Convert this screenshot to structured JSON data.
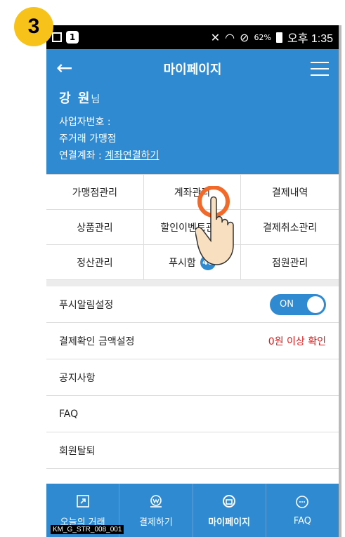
{
  "step_number": "3",
  "status_bar": {
    "indicator": "1",
    "battery": "62%",
    "time": "오후 1:35"
  },
  "header": {
    "title": "마이페이지",
    "user_name": "강 원",
    "user_suffix": "님",
    "business_number_label": "사업자번호 :",
    "main_merchant_label": "주거래 가맹점",
    "linked_account_label": "연결계좌 : ",
    "linked_account_link": "계좌연결하기"
  },
  "grid": [
    {
      "label": "가맹점관리"
    },
    {
      "label": "계좌관리"
    },
    {
      "label": "결제내역"
    },
    {
      "label": "상품관리"
    },
    {
      "label": "할인이벤트관리"
    },
    {
      "label": "결제취소관리"
    },
    {
      "label": "정산관리"
    },
    {
      "label": "푸시함",
      "count": "48"
    },
    {
      "label": "점원관리"
    }
  ],
  "settings": {
    "push_label": "푸시알림설정",
    "push_toggle": "ON",
    "amount_label": "결제확인 금액설정",
    "amount_value": "0원 이상 확인",
    "notice_label": "공지사항",
    "faq_label": "FAQ",
    "withdraw_label": "회원탈퇴"
  },
  "bottom_nav": [
    {
      "label": "오늘의 거래",
      "icon": "external-link-icon"
    },
    {
      "label": "결제하기",
      "icon": "won-coin-icon"
    },
    {
      "label": "마이페이지",
      "icon": "folder-circle-icon",
      "active": true
    },
    {
      "label": "FAQ",
      "icon": "chat-bubble-icon"
    }
  ],
  "watermark": "KM_G_STR_008_001",
  "colors": {
    "primary": "#2f8ad2",
    "badge": "#f7c31b",
    "warning": "#e01818"
  }
}
